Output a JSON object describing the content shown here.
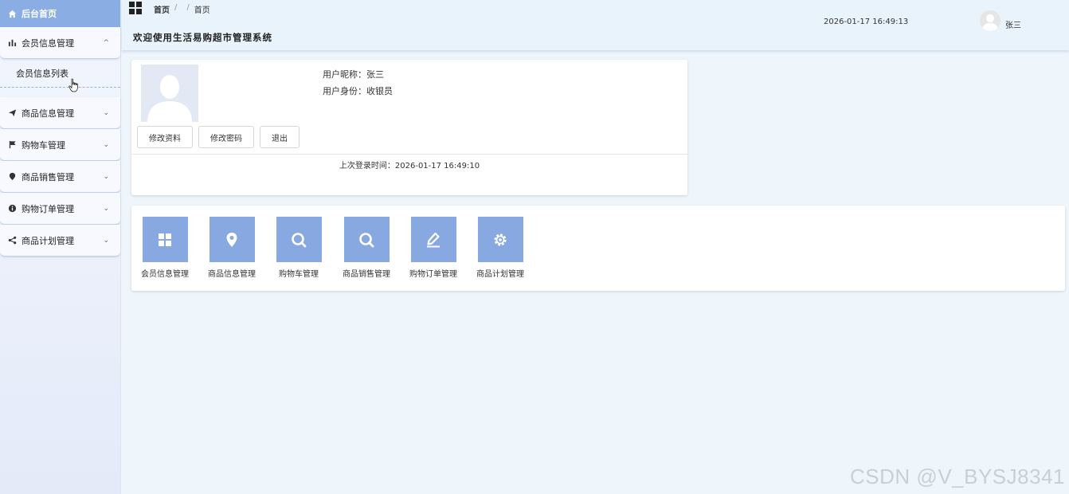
{
  "sidebar": {
    "home_label": "后台首页",
    "groups": [
      {
        "label": "会员信息管理",
        "icon": "bar-chart-icon",
        "expanded": true
      },
      {
        "label": "商品信息管理",
        "icon": "paper-plane-icon"
      },
      {
        "label": "购物车管理",
        "icon": "flag-icon"
      },
      {
        "label": "商品销售管理",
        "icon": "map-pin-icon"
      },
      {
        "label": "购物订单管理",
        "icon": "info-icon"
      },
      {
        "label": "商品计划管理",
        "icon": "share-icon"
      }
    ],
    "submenu": [
      "会员信息列表"
    ]
  },
  "header": {
    "breadcrumb": [
      "首页",
      "/",
      "/",
      "首页"
    ],
    "welcome": "欢迎使用生活易购超市管理系统",
    "datetime": "2026-01-17 16:49:13",
    "username": "张三"
  },
  "profile": {
    "nickname_line": "用户昵称：张三",
    "role_line": "用户身份：收银员",
    "buttons": {
      "edit": "修改资料",
      "password": "修改密码",
      "logout": "退出"
    },
    "last_login": "上次登录时间：2026-01-17 16:49:10"
  },
  "quick_nav": [
    {
      "label": "会员信息管理",
      "icon": "grid-icon"
    },
    {
      "label": "商品信息管理",
      "icon": "location-icon"
    },
    {
      "label": "购物车管理",
      "icon": "search-icon"
    },
    {
      "label": "商品销售管理",
      "icon": "search-icon"
    },
    {
      "label": "购物订单管理",
      "icon": "edit-icon"
    },
    {
      "label": "商品计划管理",
      "icon": "gear-icon"
    }
  ],
  "watermark": "CSDN @V_BYSJ8341",
  "colors": {
    "accent": "#87a8e0",
    "home_bg": "#8aaee3",
    "page_bg": "#eef6fc"
  }
}
